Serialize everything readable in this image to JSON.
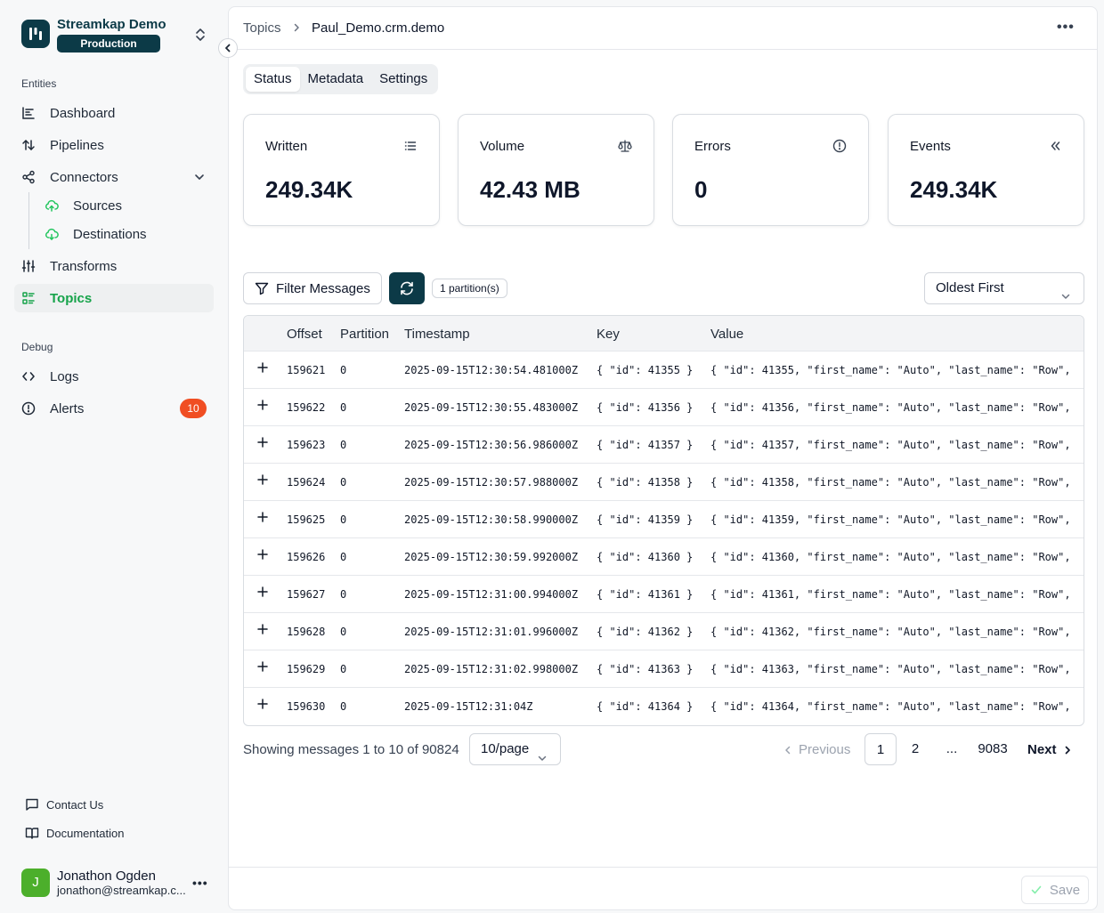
{
  "brand": {
    "name": "Streamkap Demo",
    "environment": "Production"
  },
  "sidebar": {
    "sections": {
      "entities": "Entities",
      "debug": "Debug"
    },
    "items": {
      "dashboard": "Dashboard",
      "pipelines": "Pipelines",
      "connectors": "Connectors",
      "sources": "Sources",
      "destinations": "Destinations",
      "transforms": "Transforms",
      "topics": "Topics",
      "logs": "Logs",
      "alerts": "Alerts"
    },
    "alerts_count": "10",
    "active_item": "Topics",
    "footer": {
      "contact": "Contact Us",
      "docs": "Documentation"
    },
    "user": {
      "initial": "J",
      "name": "Jonathon Ogden",
      "email": "jonathon@streamkap.c..."
    }
  },
  "header": {
    "breadcrumb_parent": "Topics",
    "breadcrumb_current": "Paul_Demo.crm.demo"
  },
  "tabs": [
    "Status",
    "Metadata",
    "Settings"
  ],
  "active_tab": "Status",
  "stats": [
    {
      "label": "Written",
      "value": "249.34K",
      "icon": "list-icon"
    },
    {
      "label": "Volume",
      "value": "42.43 MB",
      "icon": "scale-icon"
    },
    {
      "label": "Errors",
      "value": "0",
      "icon": "alert-circle-icon"
    },
    {
      "label": "Events",
      "value": "249.34K",
      "icon": "chevrons-left-icon"
    }
  ],
  "toolbar": {
    "filter_label": "Filter Messages",
    "partitions": "1 partition(s)",
    "sort": "Oldest First"
  },
  "table": {
    "columns": [
      "Offset",
      "Partition",
      "Timestamp",
      "Key",
      "Value"
    ],
    "rows": [
      {
        "offset": "159621",
        "partition": "0",
        "timestamp": "2025-09-15T12:30:54.481000Z",
        "key": "{ \"id\": 41355 }",
        "value": "{ \"id\": 41355, \"first_name\": \"Auto\", \"last_name\": \"Row\","
      },
      {
        "offset": "159622",
        "partition": "0",
        "timestamp": "2025-09-15T12:30:55.483000Z",
        "key": "{ \"id\": 41356 }",
        "value": "{ \"id\": 41356, \"first_name\": \"Auto\", \"last_name\": \"Row\","
      },
      {
        "offset": "159623",
        "partition": "0",
        "timestamp": "2025-09-15T12:30:56.986000Z",
        "key": "{ \"id\": 41357 }",
        "value": "{ \"id\": 41357, \"first_name\": \"Auto\", \"last_name\": \"Row\","
      },
      {
        "offset": "159624",
        "partition": "0",
        "timestamp": "2025-09-15T12:30:57.988000Z",
        "key": "{ \"id\": 41358 }",
        "value": "{ \"id\": 41358, \"first_name\": \"Auto\", \"last_name\": \"Row\","
      },
      {
        "offset": "159625",
        "partition": "0",
        "timestamp": "2025-09-15T12:30:58.990000Z",
        "key": "{ \"id\": 41359 }",
        "value": "{ \"id\": 41359, \"first_name\": \"Auto\", \"last_name\": \"Row\","
      },
      {
        "offset": "159626",
        "partition": "0",
        "timestamp": "2025-09-15T12:30:59.992000Z",
        "key": "{ \"id\": 41360 }",
        "value": "{ \"id\": 41360, \"first_name\": \"Auto\", \"last_name\": \"Row\","
      },
      {
        "offset": "159627",
        "partition": "0",
        "timestamp": "2025-09-15T12:31:00.994000Z",
        "key": "{ \"id\": 41361 }",
        "value": "{ \"id\": 41361, \"first_name\": \"Auto\", \"last_name\": \"Row\","
      },
      {
        "offset": "159628",
        "partition": "0",
        "timestamp": "2025-09-15T12:31:01.996000Z",
        "key": "{ \"id\": 41362 }",
        "value": "{ \"id\": 41362, \"first_name\": \"Auto\", \"last_name\": \"Row\","
      },
      {
        "offset": "159629",
        "partition": "0",
        "timestamp": "2025-09-15T12:31:02.998000Z",
        "key": "{ \"id\": 41363 }",
        "value": "{ \"id\": 41363, \"first_name\": \"Auto\", \"last_name\": \"Row\","
      },
      {
        "offset": "159630",
        "partition": "0",
        "timestamp": "2025-09-15T12:31:04Z",
        "key": "{ \"id\": 41364 }",
        "value": "{ \"id\": 41364, \"first_name\": \"Auto\", \"last_name\": \"Row\","
      }
    ]
  },
  "pagination": {
    "summary": "Showing messages 1 to 10 of 90824",
    "per_page": "10/page",
    "previous": "Previous",
    "next": "Next",
    "pages": [
      "1",
      "2",
      "...",
      "9083"
    ],
    "current": "1"
  },
  "footer": {
    "save_label": "Save"
  },
  "colors": {
    "brand": "#0c3a47",
    "active_nav": "#16a34a",
    "alert_badge": "#f04e23",
    "avatar": "#4caf2b"
  }
}
